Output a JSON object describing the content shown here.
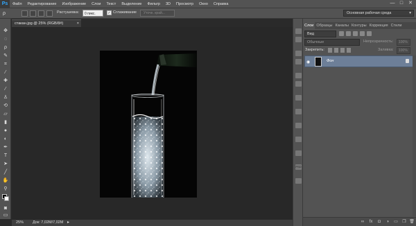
{
  "app": {
    "logo": "Ps"
  },
  "menu": [
    "Файл",
    "Редактирование",
    "Изображение",
    "Слои",
    "Текст",
    "Выделение",
    "Фильтр",
    "3D",
    "Просмотр",
    "Окно",
    "Справка"
  ],
  "window_controls": [
    "—",
    "□",
    "✕"
  ],
  "options": {
    "feather_label": "Растушевка:",
    "feather_value": "0 пикс.",
    "antialias_label": "Сглаживание",
    "antialias_checked": "✓",
    "refine_edge": "Уточн. край...",
    "workspace": "Основная рабочая среда"
  },
  "document": {
    "tab_title": "стакан.jpg @ 25% (RGB/8#)",
    "close": "×",
    "zoom": "25%",
    "doc_size": "Док: 7,02M/7,02M",
    "status_arrow": "▸"
  },
  "panels": {
    "tabs": [
      "Слои",
      "Образцы",
      "Каналы",
      "Контуры",
      "Коррекция",
      "Стили"
    ],
    "kind": "Вид",
    "blend_mode": "Обычные",
    "opacity_label": "Непрозрачность:",
    "opacity_value": "100%",
    "lock_label": "Закрепить:",
    "fill_label": "Заливка:",
    "fill_value": "100%",
    "layers": [
      {
        "name": "Фон",
        "visible": "👁"
      }
    ]
  },
  "colors": {
    "accent": "#31a8ff",
    "selected_layer": "#6d7f98",
    "foreground": "#000000",
    "background": "#ffffff"
  }
}
